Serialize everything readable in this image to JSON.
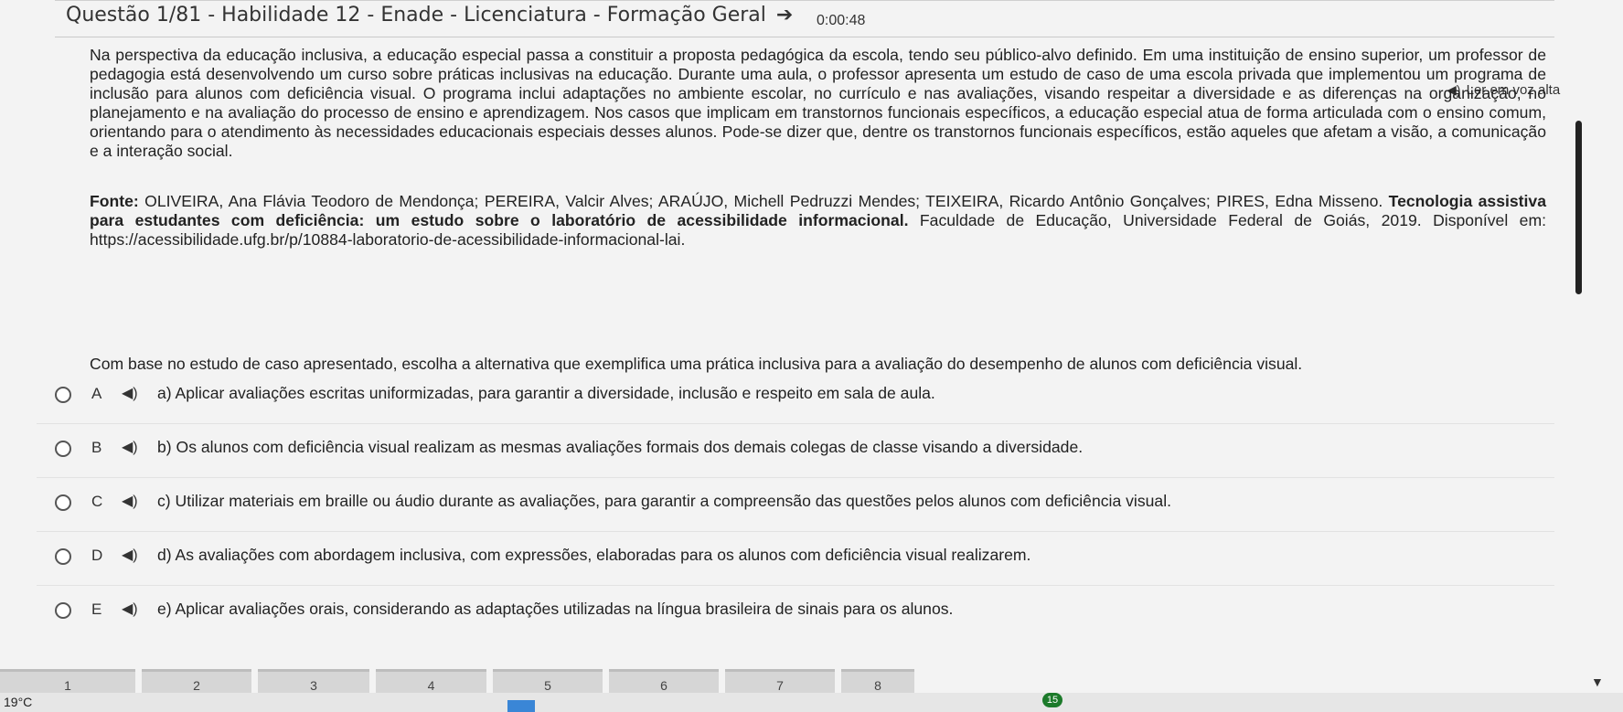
{
  "header": {
    "title": "Questão 1/81 - Habilidade 12 - Enade - Licenciatura - Formação Geral",
    "timer": "0:00:48"
  },
  "read_aloud": {
    "label": "Ler em voz alta"
  },
  "passage": "Na perspectiva da educação inclusiva, a educação especial passa a constituir a proposta pedagógica da escola, tendo seu público-alvo definido. Em uma instituição de ensino superior, um professor de pedagogia está desenvolvendo um curso sobre práticas inclusivas na educação. Durante uma aula, o professor apresenta um estudo de caso de uma escola privada que implementou um programa de inclusão para alunos com deficiência visual. O programa inclui adaptações no ambiente escolar, no currículo e nas avaliações, visando respeitar a diversidade e as diferenças na organização, no planejamento e na avaliação do processo de ensino e aprendizagem. Nos casos que implicam em transtornos funcionais específicos, a educação especial atua de forma articulada com o ensino comum, orientando para o atendimento às necessidades educacionais especiais desses alunos. Pode-se dizer que, dentre os transtornos funcionais específicos, estão aqueles que afetam a visão, a comunicação e a interação social.",
  "source": {
    "prefix": "Fonte:",
    "authors": " OLIVEIRA, Ana Flávia Teodoro de Mendonça; PEREIRA, Valcir Alves; ARAÚJO, Michell Pedruzzi Mendes; TEIXEIRA, Ricardo Antônio Gonçalves; PIRES, Edna Misseno. ",
    "title": "Tecnologia assistiva para estudantes com deficiência: um estudo sobre o laboratório de acessibilidade informacional.",
    "rest": " Faculdade de Educação, Universidade Federal de Goiás, 2019. Disponível em: https://acessibilidade.ufg.br/p/10884-laboratorio-de-acessibilidade-informacional-lai."
  },
  "question": "Com base no estudo de caso apresentado, escolha a alternativa que exemplifica uma prática inclusiva para a avaliação do desempenho de alunos com deficiência visual.",
  "options": [
    {
      "letter": "A",
      "text": "a) Aplicar avaliações escritas uniformizadas, para garantir a diversidade, inclusão e respeito em sala de aula."
    },
    {
      "letter": "B",
      "text": "b) Os alunos com deficiência visual realizam as mesmas avaliações formais dos demais colegas de classe visando a diversidade."
    },
    {
      "letter": "C",
      "text": "c) Utilizar materiais em braille ou áudio durante as avaliações, para garantir a compreensão das questões pelos alunos com deficiência visual."
    },
    {
      "letter": "D",
      "text": "d) As avaliações com abordagem inclusiva, com expressões, elaboradas para os alunos com deficiência visual realizarem."
    },
    {
      "letter": "E",
      "text": "e) Aplicar avaliações orais, considerando as adaptações utilizadas na língua brasileira de sinais para os alunos."
    }
  ],
  "pager": [
    "1",
    "2",
    "3",
    "4",
    "5",
    "6",
    "7",
    "8"
  ],
  "taskbar": {
    "temperature": "19°C",
    "badge": "15"
  },
  "icons": {
    "speaker": "speaker-icon",
    "arrow": "arrow-right-icon",
    "dropdown": "dropdown-arrow-icon"
  }
}
